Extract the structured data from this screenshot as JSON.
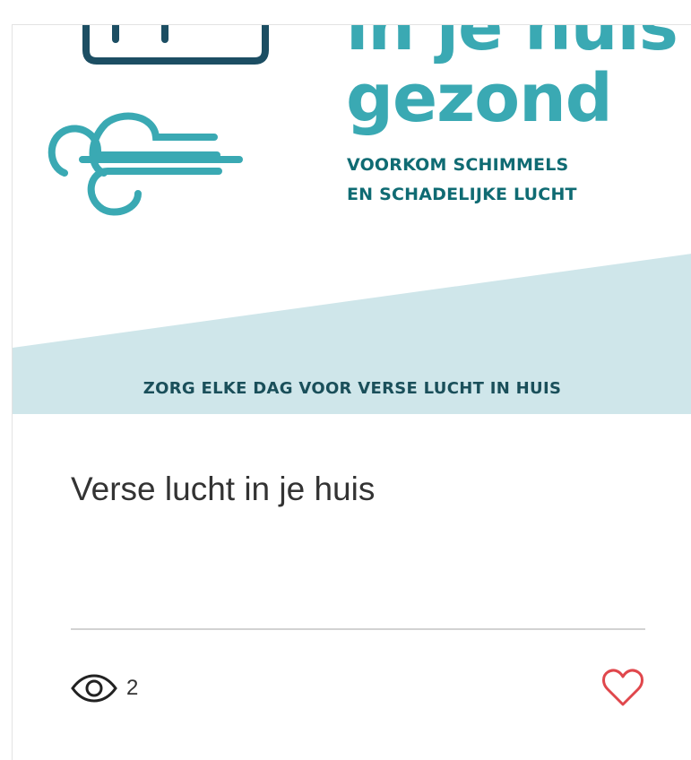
{
  "hero": {
    "headline_line1": "in je huis",
    "headline_line2": "gezond",
    "subhead_line1": "VOORKOM SCHIMMELS",
    "subhead_line2": "EN SCHADELIJKE LUCHT",
    "banner_text": "ZORG ELKE DAG VOOR VERSE LUCHT IN HUIS",
    "colors": {
      "headline": "#3aa9b3",
      "subhead": "#0f6b73",
      "banner_bg": "#cfe6ea",
      "banner_text": "#1a4f5a",
      "icon_window": "#1c4e63",
      "icon_wind": "#3aa9b3"
    },
    "icons": [
      "window-icon",
      "wind-icon"
    ]
  },
  "post": {
    "title": "Verse lucht in je huis",
    "views": "2",
    "views_icon": "eye-icon",
    "like_icon": "heart-icon",
    "like_color": "#e0474c"
  }
}
